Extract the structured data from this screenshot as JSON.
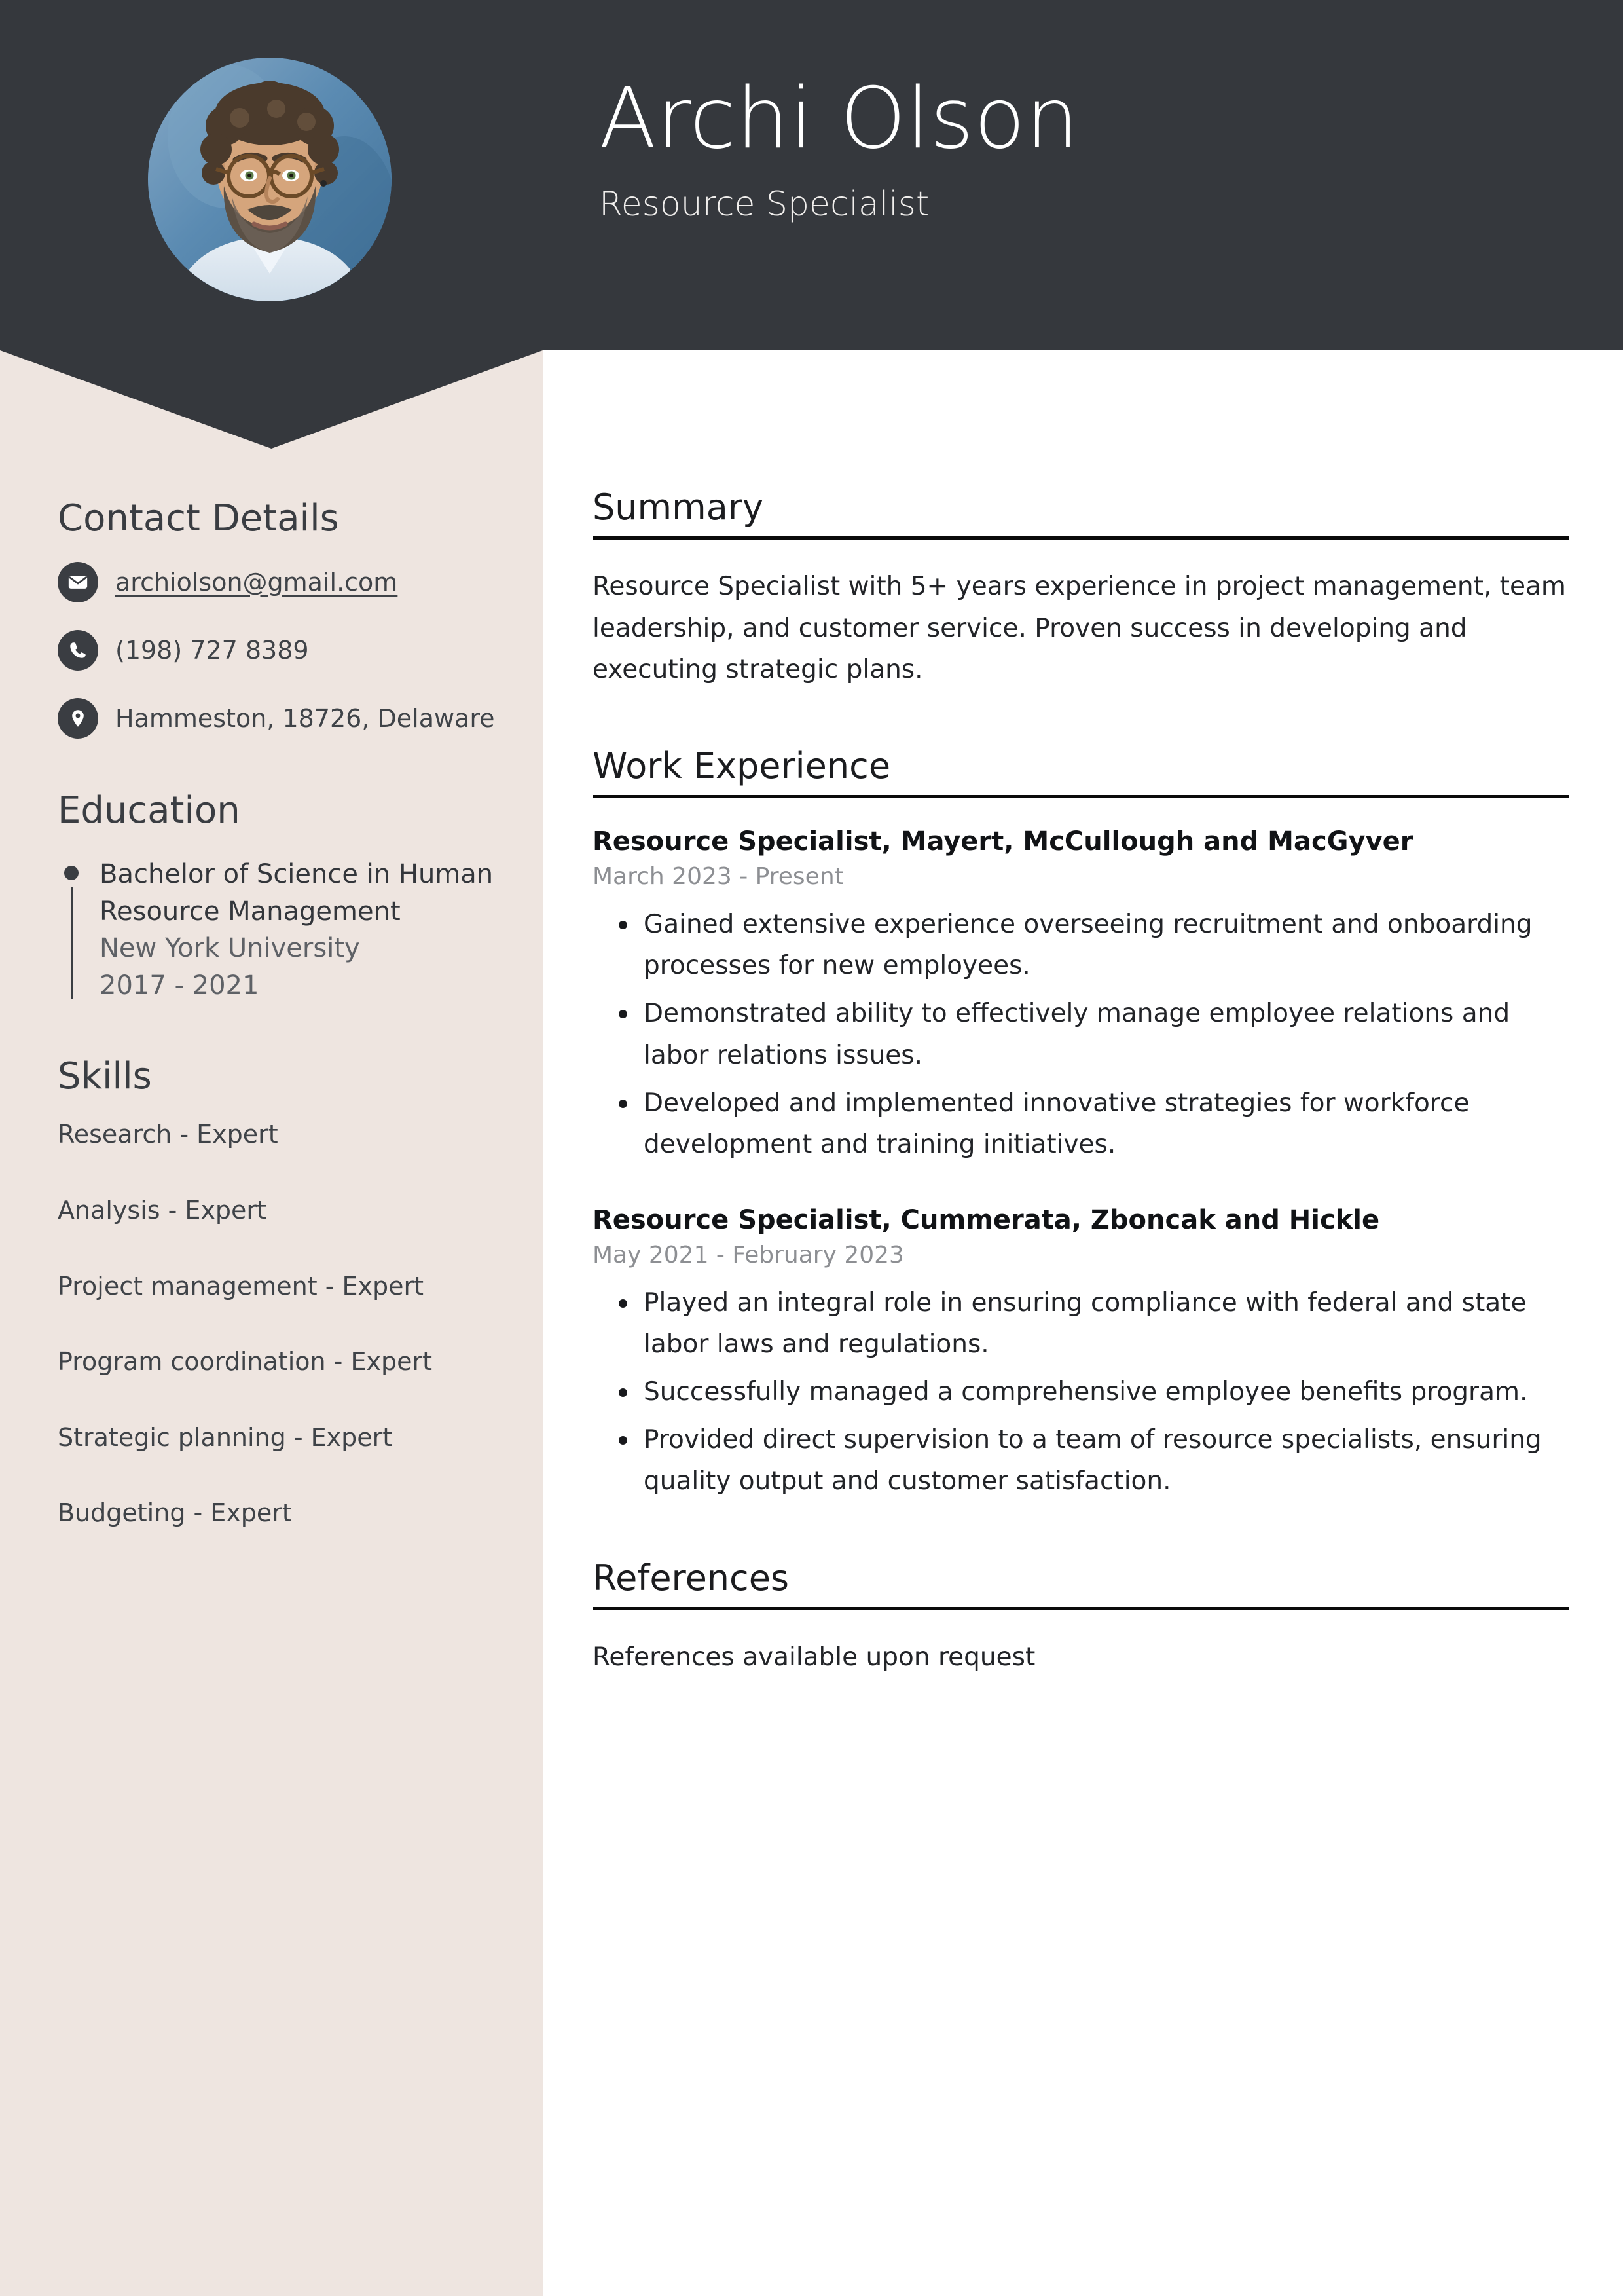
{
  "colors": {
    "header_bg": "#35383D",
    "sidebar_bg": "#EEE5E0",
    "page_bg": "#FFFFFF",
    "icon_bg": "#3A3D42",
    "rule": "#0A0A0A",
    "muted_text": "#8D8F93"
  },
  "header": {
    "name": "Archi Olson",
    "job_title": "Resource Specialist",
    "avatar_alt": "profile-photo"
  },
  "sidebar": {
    "contact": {
      "heading": "Contact Details",
      "items": [
        {
          "icon": "envelope-icon",
          "label": "archiolson@gmail.com",
          "link": true
        },
        {
          "icon": "phone-icon",
          "label": "(198) 727 8389",
          "link": false
        },
        {
          "icon": "location-pin-icon",
          "label": "Hammeston, 18726, Delaware",
          "link": false
        }
      ]
    },
    "education": {
      "heading": "Education",
      "items": [
        {
          "degree": "Bachelor of Science in Human Resource Management",
          "school": "New York University",
          "dates": "2017 - 2021"
        }
      ]
    },
    "skills": {
      "heading": "Skills",
      "items": [
        "Research - Expert",
        "Analysis - Expert",
        "Project management - Expert",
        "Program coordination - Expert",
        "Strategic planning - Expert",
        "Budgeting - Expert"
      ]
    }
  },
  "main": {
    "summary": {
      "heading": "Summary",
      "text": "Resource Specialist with 5+ years experience in project management, team leadership, and customer service. Proven success in developing and executing strategic plans."
    },
    "work_experience": {
      "heading": "Work Experience",
      "jobs": [
        {
          "title": "Resource Specialist, Mayert, McCullough and MacGyver",
          "dates": "March 2023 - Present",
          "bullets": [
            "Gained extensive experience overseeing recruitment and onboarding processes for new employees.",
            "Demonstrated ability to effectively manage employee relations and labor relations issues.",
            "Developed and implemented innovative strategies for workforce development and training initiatives."
          ]
        },
        {
          "title": "Resource Specialist, Cummerata, Zboncak and Hickle",
          "dates": "May 2021 - February 2023",
          "bullets": [
            "Played an integral role in ensuring compliance with federal and state labor laws and regulations.",
            "Successfully managed a comprehensive employee benefits program.",
            "Provided direct supervision to a team of resource specialists, ensuring quality output and customer satisfaction."
          ]
        }
      ]
    },
    "references": {
      "heading": "References",
      "text": "References available upon request"
    }
  }
}
